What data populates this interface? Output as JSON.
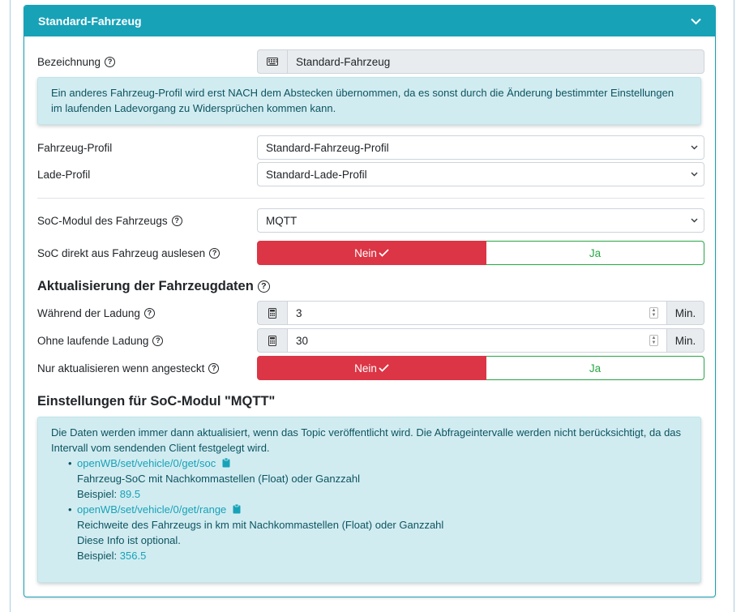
{
  "card": {
    "title": "Standard-Fahrzeug"
  },
  "bezeichnung": {
    "label": "Bezeichnung",
    "value": "Standard-Fahrzeug"
  },
  "profile_info": "Ein anderes Fahrzeug-Profil wird erst NACH dem Abstecken übernommen, da es sonst durch die Änderung bestimmter Einstellungen im laufenden Ladevorgang zu Widersprüchen kommen kann.",
  "fahrzeug_profil": {
    "label": "Fahrzeug-Profil",
    "value": "Standard-Fahrzeug-Profil"
  },
  "lade_profil": {
    "label": "Lade-Profil",
    "value": "Standard-Lade-Profil"
  },
  "soc_modul": {
    "label": "SoC-Modul des Fahrzeugs",
    "value": "MQTT"
  },
  "soc_direkt": {
    "label": "SoC direkt aus Fahrzeug auslesen",
    "no": "Nein",
    "yes": "Ja",
    "selected": "Nein"
  },
  "update_heading": "Aktualisierung der Fahrzeugdaten",
  "waehrend": {
    "label": "Während der Ladung",
    "value": "3",
    "unit": "Min."
  },
  "ohne": {
    "label": "Ohne laufende Ladung",
    "value": "30",
    "unit": "Min."
  },
  "nur_angesteckt": {
    "label": "Nur aktualisieren wenn angesteckt",
    "no": "Nein",
    "yes": "Ja",
    "selected": "Nein"
  },
  "mqtt_heading": "Einstellungen für SoC-Modul \"MQTT\"",
  "mqtt_info": {
    "intro": "Die Daten werden immer dann aktualisiert, wenn das Topic veröffentlicht wird. Die Abfrageintervalle werden nicht berücksichtigt, da das Intervall vom sendenden Client festgelegt wird.",
    "topics": [
      {
        "topic": "openWB/set/vehicle/0/get/soc",
        "desc": "Fahrzeug-SoC mit Nachkommastellen (Float) oder Ganzzahl",
        "example_label": "Beispiel:",
        "example_value": "89.5"
      },
      {
        "topic": "openWB/set/vehicle/0/get/range",
        "desc": "Reichweite des Fahrzeugs in km mit Nachkommastellen (Float) oder Ganzzahl",
        "note": "Diese Info ist optional.",
        "example_label": "Beispiel:",
        "example_value": "356.5"
      }
    ]
  },
  "icons": {
    "help": "question-circle-icon",
    "keyboard": "keyboard-icon",
    "calculator": "calculator-icon",
    "clipboard": "clipboard-icon",
    "chevron": "chevron-down-icon",
    "check": "check-icon"
  },
  "colors": {
    "primary": "#17a2b8",
    "danger": "#dc3545",
    "success": "#28a745",
    "info_bg": "#d1ecf1"
  }
}
